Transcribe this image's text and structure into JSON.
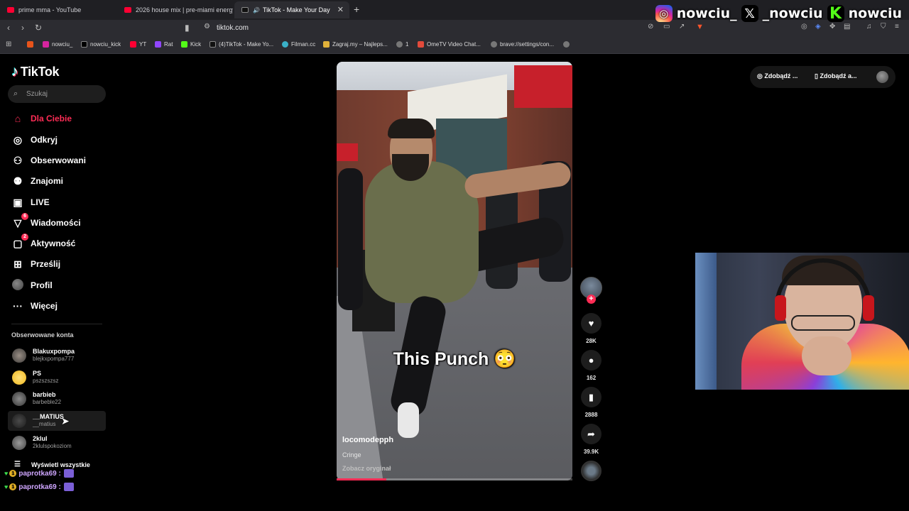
{
  "browser": {
    "tabs": [
      {
        "title": "prime mma - YouTube",
        "favicon_color": "#ff0033"
      },
      {
        "title": "2026 house mix | pre-miami energy",
        "favicon_color": "#ff0033"
      },
      {
        "title": "TikTok - Make Your Day",
        "favicon_color": "#000000",
        "active": true
      }
    ],
    "new_tab": "+",
    "url": "tiktok.com",
    "bookmarks": [
      "nowciu_",
      "nowciu_kick",
      "YT",
      "Rat",
      "Kick",
      "(4)TikTok - Make Yo...",
      "Filman.cc",
      "Zagraj.my – Najleps...",
      "1",
      "OmeTV Video Chat...",
      "brave://settings/con..."
    ]
  },
  "stream_overlay": {
    "instagram": "nowciu_",
    "x": "_nowciu",
    "kick": "nowciu"
  },
  "tiktok": {
    "brand": "TikTok",
    "search_placeholder": "Szukaj",
    "nav": [
      {
        "label": "Dla Ciebie",
        "icon": "home-icon",
        "active": true
      },
      {
        "label": "Odkryj",
        "icon": "compass-icon"
      },
      {
        "label": "Obserwowani",
        "icon": "following-icon"
      },
      {
        "label": "Znajomi",
        "icon": "friends-icon"
      },
      {
        "label": "LIVE",
        "icon": "live-icon"
      },
      {
        "label": "Wiadomości",
        "icon": "messages-icon",
        "badge": "6"
      },
      {
        "label": "Aktywność",
        "icon": "activity-icon",
        "badge": "2"
      },
      {
        "label": "Prześlij",
        "icon": "upload-icon"
      },
      {
        "label": "Profil",
        "icon": "profile-avatar"
      },
      {
        "label": "Więcej",
        "icon": "more-icon"
      }
    ],
    "following_title": "Obserwowane konta",
    "following": [
      {
        "name": "Blakuxpompa",
        "handle": "blejkxpompa777"
      },
      {
        "name": "PS",
        "handle": "pszszszsz"
      },
      {
        "name": "barbieb",
        "handle": "barbeble22"
      },
      {
        "name": "__MATIUS",
        "handle": "__matius"
      },
      {
        "name": "2klul",
        "handle": "2klulspokoziom"
      }
    ],
    "see_all": "Wyświetl wszystkie",
    "video": {
      "caption": "This Punch 😳",
      "author": "locomodepph",
      "description": "Cringe",
      "see_original": "Zobacz oryginał",
      "progress": 0.21
    },
    "actions": {
      "likes": "28K",
      "comments": "162",
      "saves": "2888",
      "shares": "39.9K"
    },
    "top_right": {
      "btn1": "Zdobądź ...",
      "btn2": "Zdobądź a..."
    }
  },
  "chat": [
    {
      "user": "paprotka69 :"
    },
    {
      "user": "paprotka69 :"
    }
  ],
  "colors": {
    "accent": "#fe2c55",
    "kick_green": "#53fc18"
  }
}
